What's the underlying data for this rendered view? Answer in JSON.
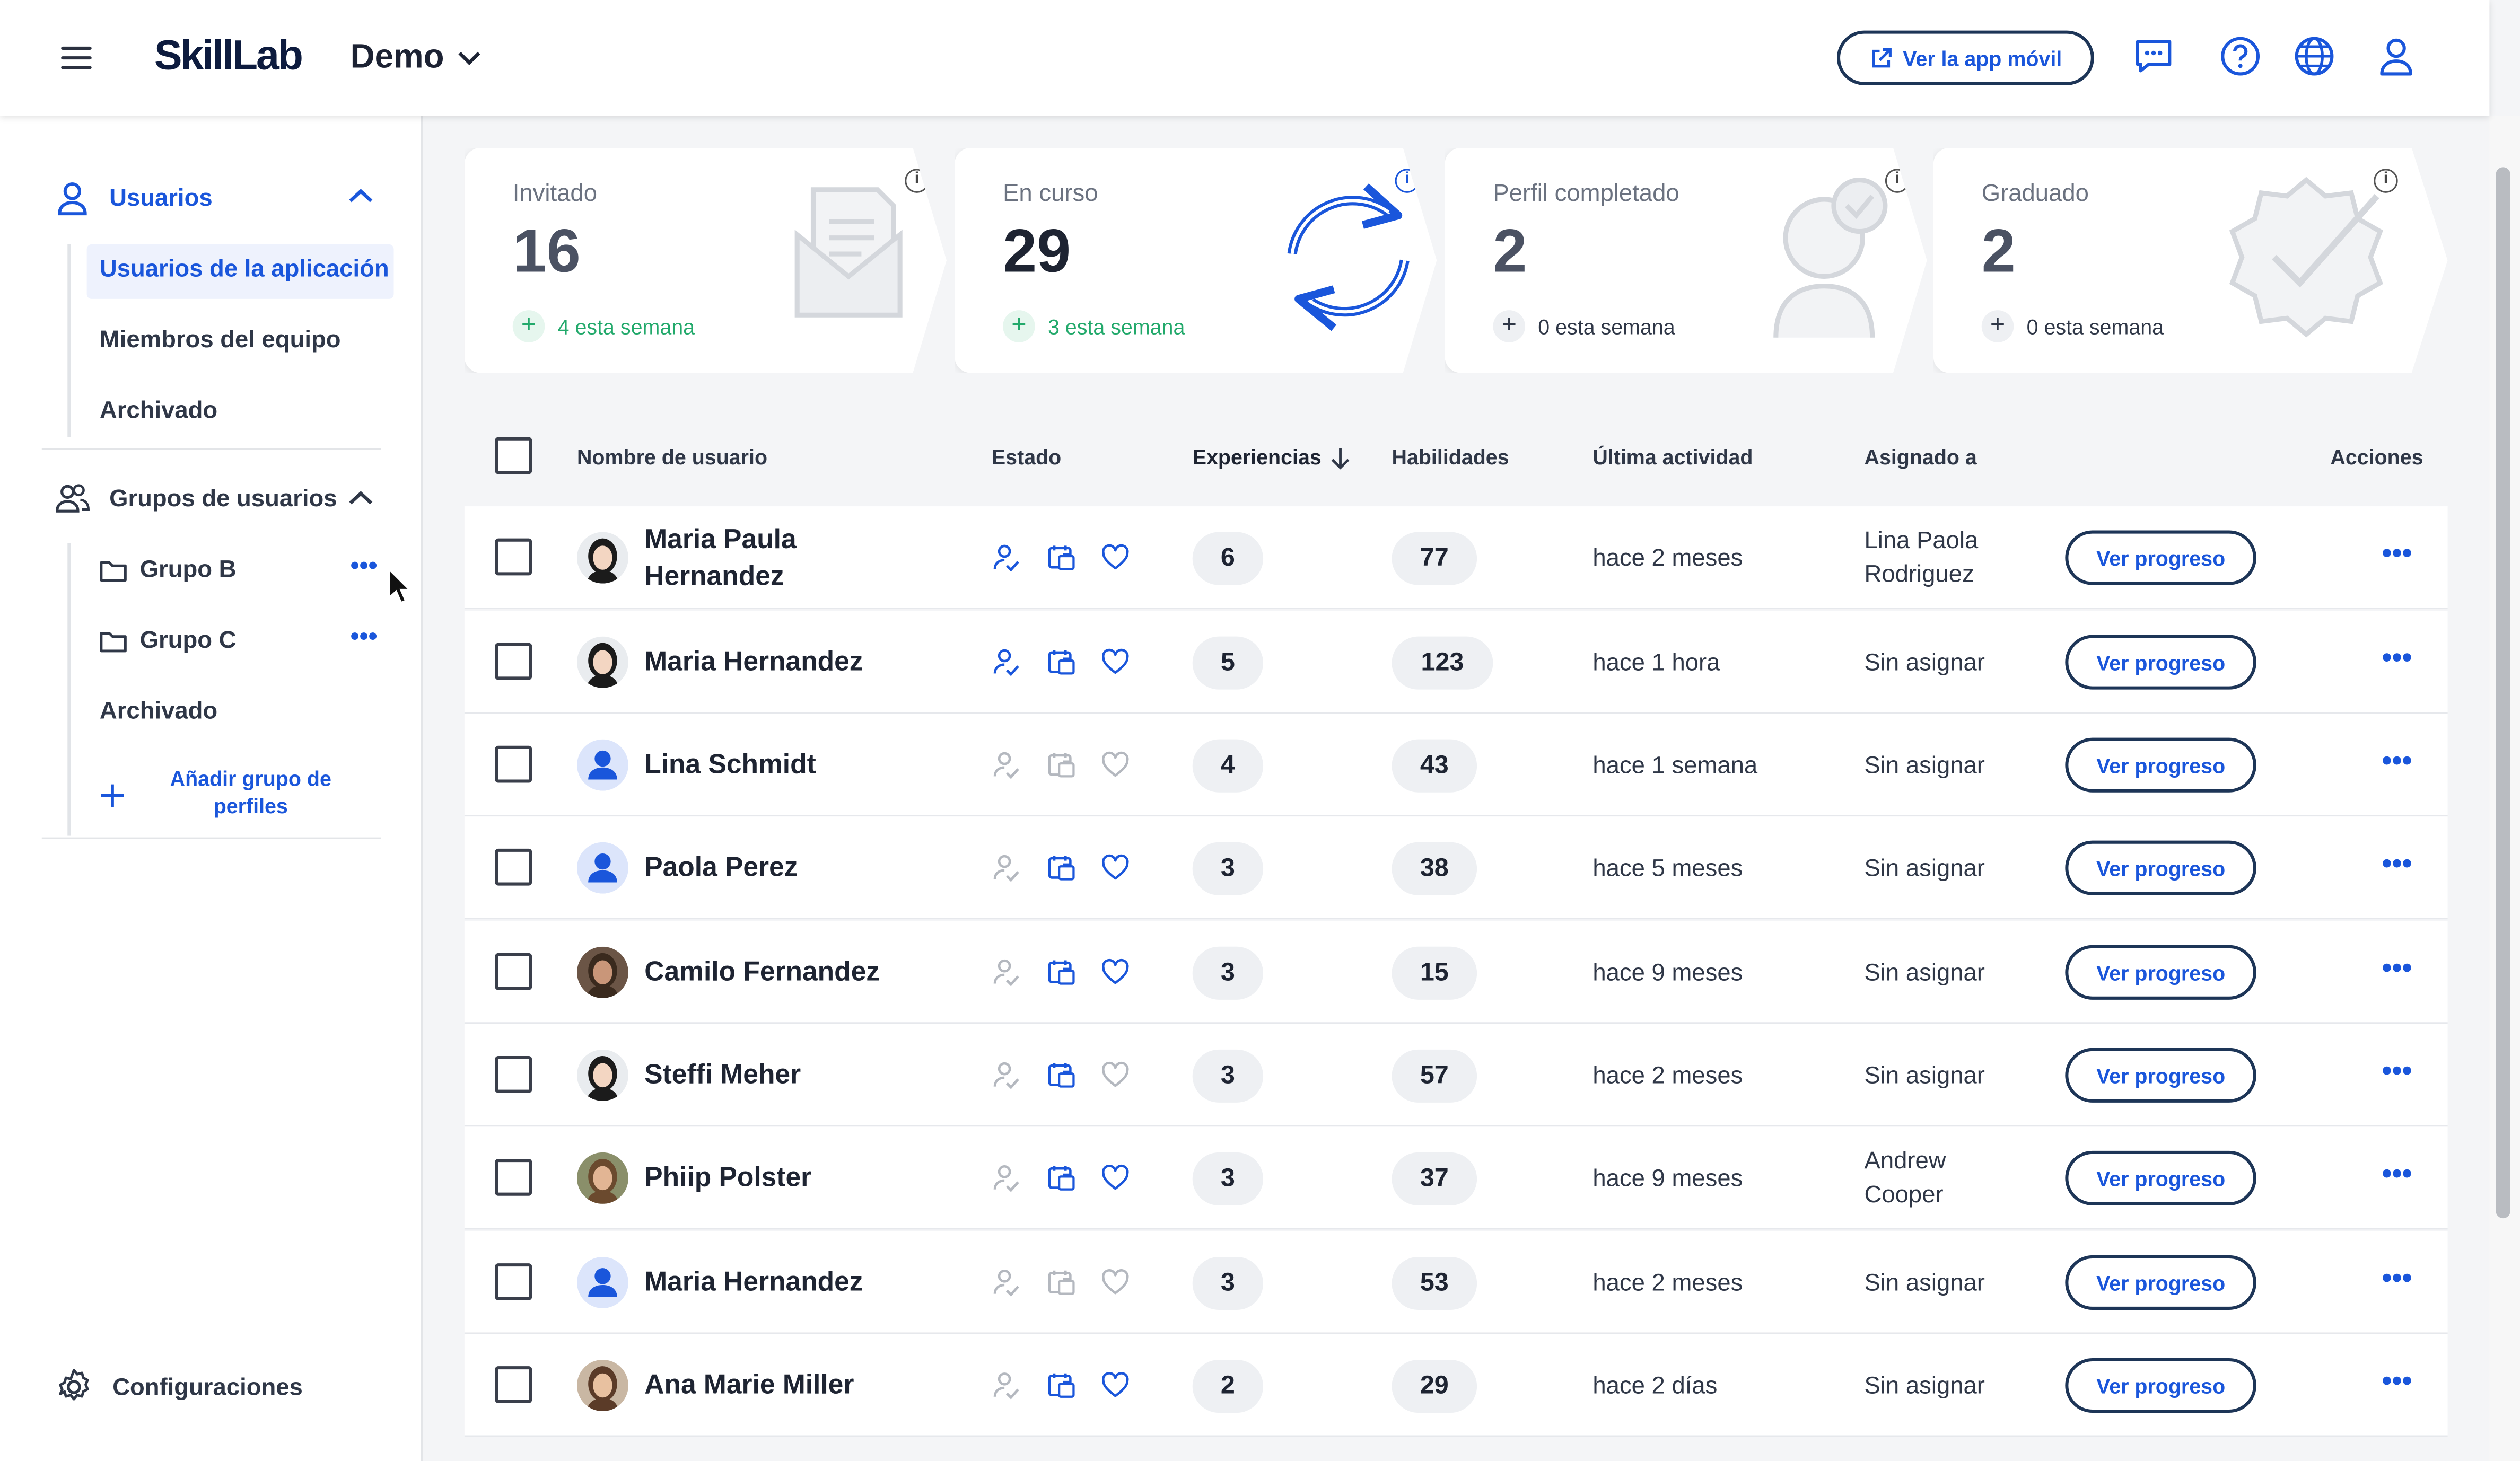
{
  "header": {
    "logo": "SkillLab",
    "org_name": "Demo",
    "mobile_app_button": "Ver la app móvil"
  },
  "sidebar": {
    "users_section": "Usuarios",
    "user_items": [
      "Usuarios de la aplicación",
      "Miembros del equipo",
      "Archivado"
    ],
    "groups_section": "Grupos de usuarios",
    "groups": [
      "Grupo B",
      "Grupo C"
    ],
    "groups_archived": "Archivado",
    "add_group": "Añadir grupo de perfiles",
    "settings": "Configuraciones"
  },
  "cards": [
    {
      "title": "Invitado",
      "value": "16",
      "delta": "4 esta semana"
    },
    {
      "title": "En curso",
      "value": "29",
      "delta": "3 esta semana"
    },
    {
      "title": "Perfil completado",
      "value": "2",
      "delta": "0 esta semana"
    },
    {
      "title": "Graduado",
      "value": "2",
      "delta": "0 esta semana"
    }
  ],
  "table": {
    "columns": {
      "username": "Nombre de usuario",
      "status": "Estado",
      "experiences": "Experiencias",
      "skills": "Habilidades",
      "last_activity": "Última actividad",
      "assigned_to": "Asignado a",
      "actions": "Acciones"
    },
    "progress_button": "Ver progreso",
    "rows": [
      {
        "name": "Maria Paula Hernandez",
        "experiences": "6",
        "skills": "77",
        "last_activity": "hace 2 meses",
        "assigned": "Lina Paola Rodriguez"
      },
      {
        "name": "Maria Hernandez",
        "experiences": "5",
        "skills": "123",
        "last_activity": "hace 1 hora",
        "assigned": "Sin asignar"
      },
      {
        "name": "Lina Schmidt",
        "experiences": "4",
        "skills": "43",
        "last_activity": "hace 1 semana",
        "assigned": "Sin asignar"
      },
      {
        "name": "Paola Perez",
        "experiences": "3",
        "skills": "38",
        "last_activity": "hace 5 meses",
        "assigned": "Sin asignar"
      },
      {
        "name": "Camilo Fernandez",
        "experiences": "3",
        "skills": "15",
        "last_activity": "hace 9 meses",
        "assigned": "Sin asignar"
      },
      {
        "name": "Steffi Meher",
        "experiences": "3",
        "skills": "57",
        "last_activity": "hace 2 meses",
        "assigned": "Sin asignar"
      },
      {
        "name": "Phiip Polster",
        "experiences": "3",
        "skills": "37",
        "last_activity": "hace 9 meses",
        "assigned": "Andrew Cooper"
      },
      {
        "name": "Maria Hernandez",
        "experiences": "3",
        "skills": "53",
        "last_activity": "hace 2 meses",
        "assigned": "Sin asignar"
      },
      {
        "name": "Ana Marie Miller",
        "experiences": "2",
        "skills": "29",
        "last_activity": "hace 2 días",
        "assigned": "Sin asignar"
      }
    ]
  },
  "colors": {
    "accent": "#1a56db",
    "positive": "#22a96b",
    "text_dark": "#1e2432",
    "muted": "#6b7280"
  }
}
